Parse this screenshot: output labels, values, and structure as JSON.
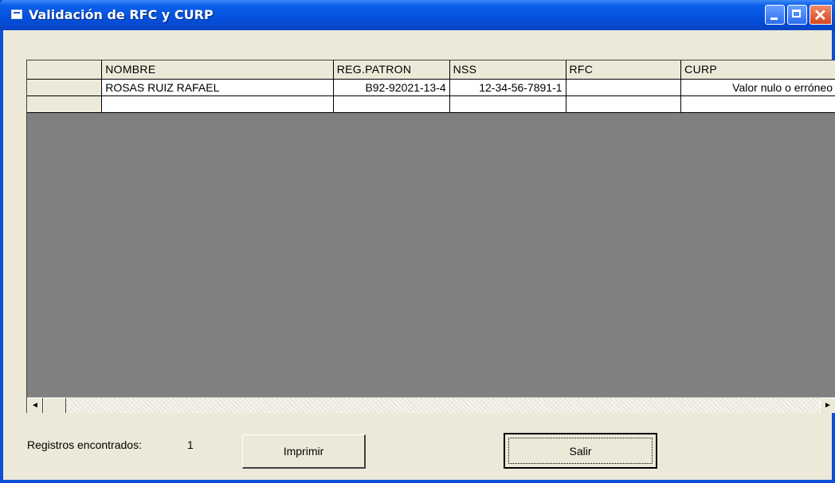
{
  "window": {
    "title": "Validación de RFC y CURP"
  },
  "grid": {
    "columns": [
      "",
      "NOMBRE",
      "REG.PATRON",
      "NSS",
      "RFC",
      "CURP"
    ],
    "rows": [
      [
        "",
        "ROSAS RUIZ RAFAEL",
        "B92-92021-13-4",
        "12-34-56-7891-1",
        "",
        "Valor nulo o erróneo"
      ],
      [
        "",
        "",
        "",
        "",
        "",
        ""
      ]
    ],
    "scroll_left_glyph": "◄",
    "scroll_right_glyph": "►"
  },
  "status": {
    "label": "Registros encontrados:",
    "count": "1"
  },
  "buttons": {
    "print": "Imprimir",
    "exit": "Salir"
  },
  "colors": {
    "titlebar": "#0550dd",
    "grid_background": "#808080",
    "window_face": "#ece9d8"
  }
}
